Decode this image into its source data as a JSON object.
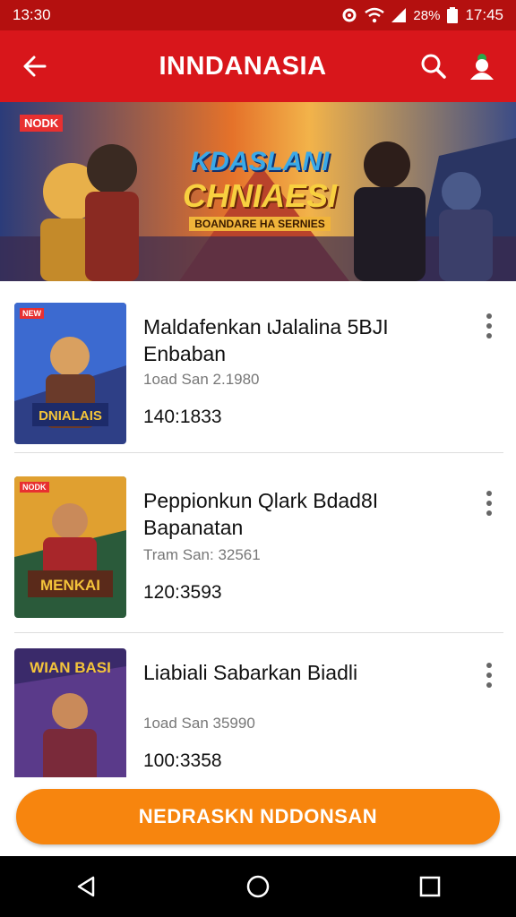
{
  "status_bar": {
    "time_left": "13:30",
    "battery": "28%",
    "time_right": "17:45"
  },
  "app_bar": {
    "title": "INNDANASIA"
  },
  "banner": {
    "badge": "NODK",
    "title_line1": "KDASLANI",
    "title_line2": "CHNIAESI",
    "subtitle": "BOANDARE HA SERNIES"
  },
  "items": [
    {
      "title": "Maldafenkan ɩJalalina 5BJI Enbaban",
      "subtitle": "1oad San 2.1980",
      "time": "140:1833",
      "thumb_badge": "NEW",
      "thumb_text": "DNIALAIS"
    },
    {
      "title": "Peppionkun Qlark Bdad8I Bapanatan",
      "subtitle": "Tram San: 32561",
      "time": "120:3593",
      "thumb_badge": "NODK",
      "thumb_text": "MENKAI"
    },
    {
      "title": "Liabiali Sabarkan Biadli",
      "subtitle": "1oad San 35990",
      "time": "100:3358",
      "thumb_badge": "",
      "thumb_text": "WIAN BASI"
    }
  ],
  "cta": {
    "label": "NEDRASKN NDDONSAN"
  },
  "colors": {
    "status": "#b4100f",
    "appbar": "#d8161b",
    "accent": "#f7850e"
  }
}
